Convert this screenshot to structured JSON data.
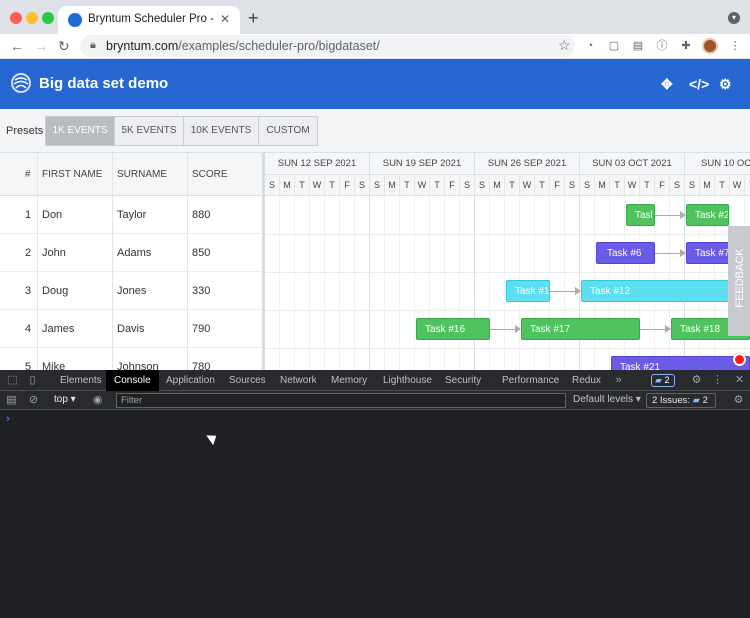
{
  "browser": {
    "tab_title": "Bryntum Scheduler Pro - Big d",
    "url_host": "bryntum.com",
    "url_path": "/examples/scheduler-pro/bigdataset/"
  },
  "app": {
    "title": "Big data set demo"
  },
  "presets": {
    "label": "Presets",
    "buttons": [
      "1K EVENTS",
      "5K EVENTS",
      "10K EVENTS",
      "CUSTOM"
    ],
    "active": "1K EVENTS"
  },
  "grid": {
    "columns": [
      "#",
      "FIRST NAME",
      "SURNAME",
      "SCORE"
    ],
    "rows": [
      {
        "n": "1",
        "first": "Don",
        "last": "Taylor",
        "score": "880"
      },
      {
        "n": "2",
        "first": "John",
        "last": "Adams",
        "score": "850"
      },
      {
        "n": "3",
        "first": "Doug",
        "last": "Jones",
        "score": "330"
      },
      {
        "n": "4",
        "first": "James",
        "last": "Davis",
        "score": "790"
      },
      {
        "n": "5",
        "first": "Mike",
        "last": "Johnson",
        "score": "780"
      }
    ]
  },
  "timeline": {
    "weeks": [
      "SUN 12 SEP 2021",
      "SUN 19 SEP 2021",
      "SUN 26 SEP 2021",
      "SUN 03 OCT 2021",
      "SUN 10 OCT"
    ],
    "days": [
      "S",
      "M",
      "T",
      "W",
      "T",
      "F",
      "S"
    ],
    "tasks": [
      {
        "label": "Tasl",
        "color": "green"
      },
      {
        "label": "Task #2",
        "color": "green"
      },
      {
        "label": "Task #6",
        "color": "purple"
      },
      {
        "label": "Task #7",
        "color": "purple"
      },
      {
        "label": "Task #1",
        "color": "cyan"
      },
      {
        "label": "Task #12",
        "color": "cyan"
      },
      {
        "label": "Task #16",
        "color": "green"
      },
      {
        "label": "Task #17",
        "color": "green"
      },
      {
        "label": "Task #18",
        "color": "green"
      },
      {
        "label": "Task #21",
        "color": "purple"
      }
    ],
    "feedback": "FEEDBACK"
  },
  "devtools": {
    "tabs": [
      "Elements",
      "Console",
      "Application",
      "Sources",
      "Network",
      "Memory",
      "Lighthouse",
      "Security",
      "Performance",
      "Redux"
    ],
    "active_tab": "Console",
    "badge_count": "2",
    "context": "top",
    "filter_placeholder": "Filter",
    "levels": "Default levels",
    "issues_label": "2 Issues:",
    "issues_count": "2"
  },
  "colors": {
    "app_header": "#2667d1",
    "task_green": "#4fc35e",
    "task_purple": "#6a5ce6",
    "task_cyan": "#5ce0f0"
  }
}
